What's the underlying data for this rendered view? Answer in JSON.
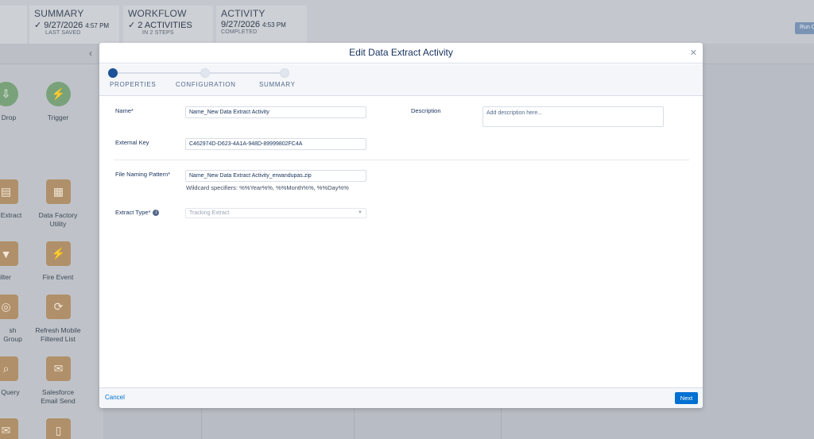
{
  "header": {
    "summary": {
      "title": "SUMMARY",
      "date": "9/27/2026",
      "time": "4:57 PM",
      "status": "LAST SAVED"
    },
    "workflow": {
      "title": "WORKFLOW",
      "value": "2 ACTIVITIES",
      "sub": "IN 2 STEPS"
    },
    "activity": {
      "title": "ACTIVITY",
      "date": "9/27/2026",
      "time": "4:53 PM",
      "status": "COMPLETED"
    },
    "run_label": "Run O"
  },
  "palette": {
    "items": [
      {
        "label": "Drop",
        "icon": "drop-icon"
      },
      {
        "label": "Trigger",
        "icon": "lightning-icon"
      },
      {
        "label": "Extract",
        "icon": "extract-icon"
      },
      {
        "label": "Data Factory Utility",
        "icon": "data-factory-icon"
      },
      {
        "label": "ilter",
        "icon": "filter-icon"
      },
      {
        "label": "Fire Event",
        "icon": "lightning-icon"
      },
      {
        "label": "sh Group",
        "icon": "group-icon"
      },
      {
        "label": "Refresh Mobile Filtered List",
        "icon": "mobile-refresh-icon"
      },
      {
        "label": "Query",
        "icon": "query-icon"
      },
      {
        "label": "Salesforce Email Send",
        "icon": "email-icon"
      }
    ]
  },
  "modal": {
    "title": "Edit Data Extract Activity",
    "steps": [
      "PROPERTIES",
      "CONFIGURATION",
      "SUMMARY"
    ],
    "active_step": 0,
    "fields": {
      "name_label": "Name*",
      "name_value": "Name_New Data Extract Activity",
      "description_label": "Description",
      "description_placeholder": "Add description here...",
      "external_key_label": "External Key",
      "external_key_value": "C462974D-D623-4A1A-948D-89999802FC4A",
      "file_naming_label": "File Naming Pattern*",
      "file_naming_value": "Name_New Data Extract Activity_erwandupas.zip",
      "wildcard_hint": "Wildcard specifiers: %%Year%%, %%Month%%, %%Day%%",
      "extract_type_label": "Extract Type*",
      "extract_type_value": "Tracking Extract"
    },
    "footer": {
      "cancel_label": "Cancel",
      "next_label": "Next"
    }
  },
  "colors": {
    "brand": "#0070d2",
    "active_step": "#1b5297",
    "tile": "#b0906a"
  }
}
